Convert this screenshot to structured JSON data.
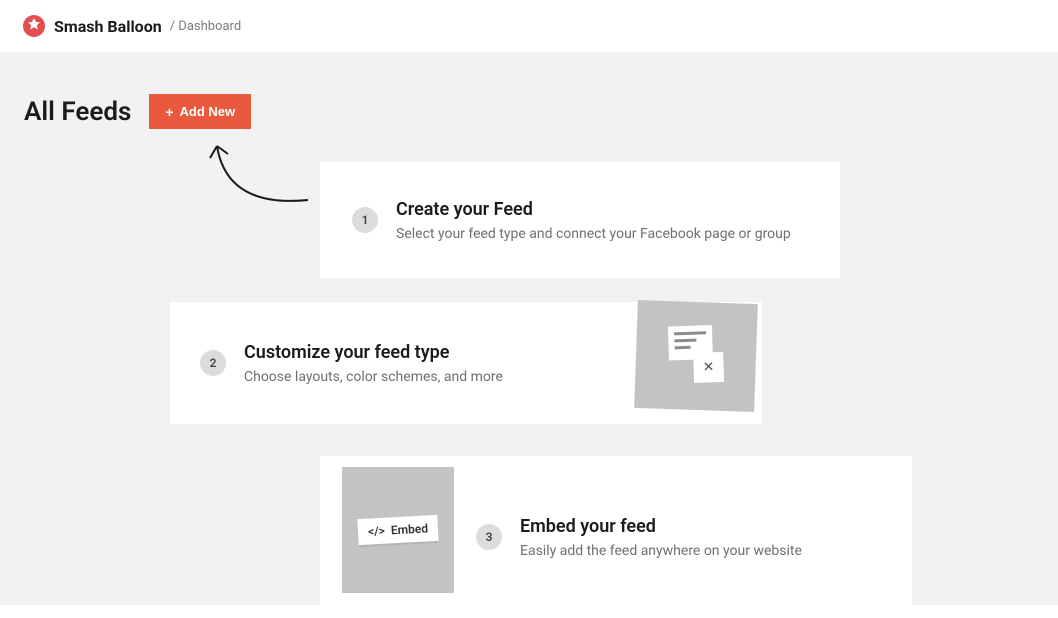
{
  "brand": "Smash Balloon",
  "breadcrumb": "/ Dashboard",
  "page_title": "All Feeds",
  "add_button_label": "Add New",
  "steps": [
    {
      "num": "1",
      "title": "Create your Feed",
      "sub": "Select your feed type and connect your Facebook page or group"
    },
    {
      "num": "2",
      "title": "Customize your feed type",
      "sub": "Choose layouts, color schemes, and more"
    },
    {
      "num": "3",
      "title": "Embed your feed",
      "sub": "Easily add the feed anywhere on your website"
    }
  ],
  "embed_label": "Embed"
}
